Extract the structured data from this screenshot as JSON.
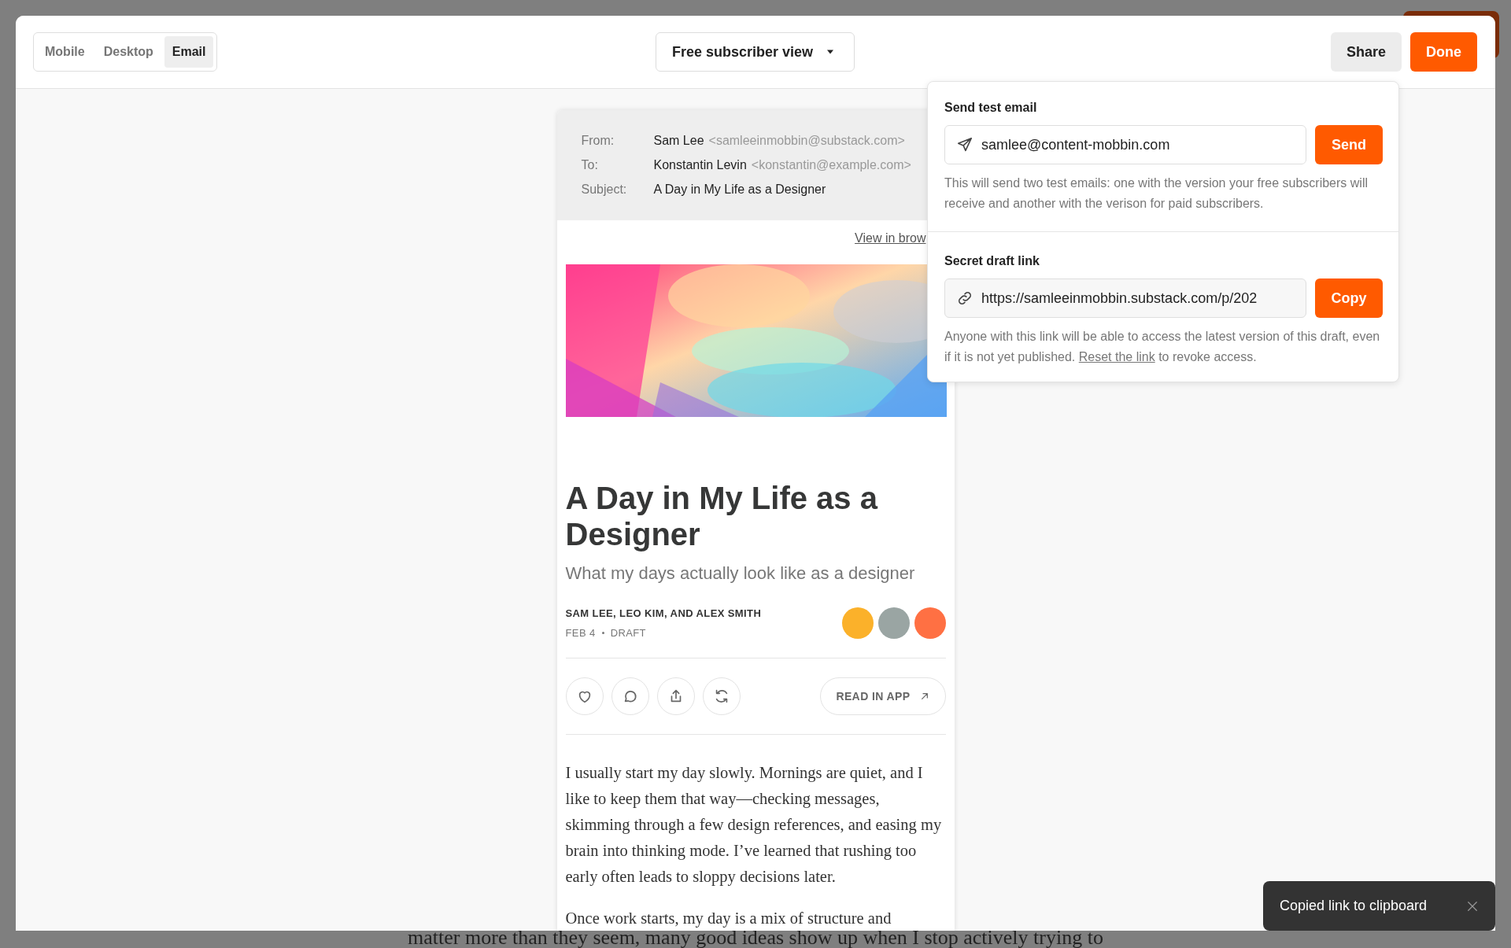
{
  "background_page": {
    "text": "matter more than they seem, many good ideas show up when I stop actively trying to"
  },
  "toolbar": {
    "view_tabs": [
      {
        "label": "Mobile",
        "selected": false
      },
      {
        "label": "Desktop",
        "selected": false
      },
      {
        "label": "Email",
        "selected": true
      }
    ],
    "audience_dropdown": {
      "label": "Free subscriber view"
    },
    "buttons": [
      {
        "label": "Share",
        "kind": "secondary"
      },
      {
        "label": "Done",
        "kind": "primary"
      }
    ]
  },
  "email": {
    "headers": [
      {
        "label": "From:",
        "name": "Sam Lee",
        "address": "<samleeinmobbin@substack.com>"
      },
      {
        "label": "To:",
        "name": "Konstantin Levin",
        "address": "<konstantin@example.com>"
      },
      {
        "label": "Subject:",
        "name": "A Day in My Life as a Designer"
      }
    ],
    "view_in_browser": "View in brow",
    "hero": {
      "kind": "picture"
    },
    "title": "A Day in My Life as a Designer",
    "subtitle": "What my days actually look like as a designer",
    "authors": "SAM LEE, LEO KIM, AND ALEX SMITH",
    "date": "FEB 4",
    "status": "DRAFT",
    "avatars": [
      {
        "color": "#fbb12a"
      },
      {
        "color": "#9aa5a3"
      },
      {
        "color": "#ff7043"
      }
    ],
    "actions": [
      {
        "kind": "like"
      },
      {
        "kind": "comment"
      },
      {
        "kind": "share"
      },
      {
        "kind": "restack"
      }
    ],
    "read_in_app": "READ IN APP",
    "paragraphs": [
      "I usually start my day slowly. Mornings are quiet, and I like to keep them that way—checking messages, skimming through a few design references, and easing my brain into thinking mode. I’ve learned that rushing too early often leads to sloppy decisions later.",
      "Once work starts, my day is a mix of structure and"
    ]
  },
  "share_popover": {
    "test_email": {
      "title": "Send test email",
      "value": "samlee@content-mobbin.com",
      "button": "Send",
      "help": "This will send two test emails: one with the version your free subscribers will receive and another with the verison for paid subscribers."
    },
    "draft_link": {
      "title": "Secret draft link",
      "value": "https://samleeinmobbin.substack.com/p/202",
      "button": "Copy",
      "help_before": "Anyone with this link will be able to access the latest version of this draft, even if it is not yet published.",
      "help_link": "Reset the link",
      "help_after": "to revoke access."
    }
  },
  "toast": {
    "message": "Copied link to clipboard"
  }
}
